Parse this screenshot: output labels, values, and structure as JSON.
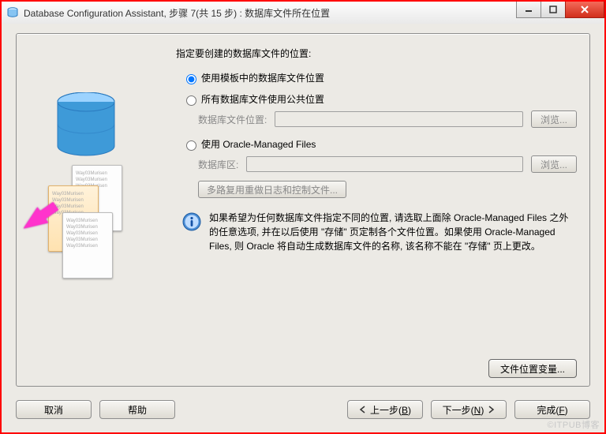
{
  "window": {
    "title": "Database Configuration Assistant, 步骤 7(共 15 步) : 数据库文件所在位置"
  },
  "heading": "指定要创建的数据库文件的位置:",
  "options": {
    "template": {
      "label": "使用模板中的数据库文件位置",
      "selected": true
    },
    "common": {
      "label": "所有数据库文件使用公共位置",
      "field_label": "数据库文件位置:",
      "value": "",
      "browse": "浏览..."
    },
    "omf": {
      "label": "使用 Oracle-Managed Files",
      "field_label": "数据库区:",
      "value": "",
      "browse": "浏览...",
      "multiplex_btn": "多路复用重做日志和控制文件..."
    }
  },
  "info_text": "如果希望为任何数据库文件指定不同的位置, 请选取上面除 Oracle-Managed Files 之外的任意选项, 并在以后使用 \"存储\" 页定制各个文件位置。如果使用 Oracle-Managed Files, 则 Oracle 将自动生成数据库文件的名称, 该名称不能在 \"存储\" 页上更改。",
  "var_button": "文件位置变量...",
  "nav": {
    "cancel": "取消",
    "help": "帮助",
    "back": "上一步(B)",
    "next": "下一步(N)",
    "finish": "完成(F)"
  },
  "watermark": "©ITPUB博客"
}
